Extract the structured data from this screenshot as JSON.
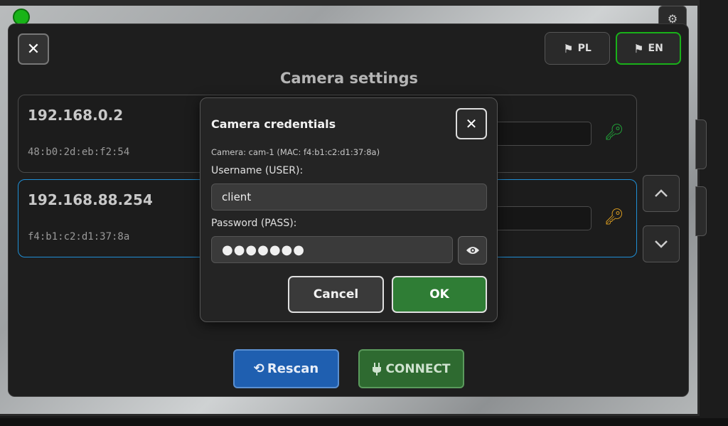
{
  "panel": {
    "title": "Camera settings",
    "close_label": "✕",
    "languages": [
      {
        "code": "PL",
        "flag_glyph": "⚑",
        "active": false
      },
      {
        "code": "EN",
        "flag_glyph": "⚑",
        "active": true
      }
    ]
  },
  "cameras": [
    {
      "ip": "192.168.0.2",
      "mac": "48:b0:2d:eb:f2:54",
      "key_status": "green",
      "selected": false
    },
    {
      "ip": "192.168.88.254",
      "mac": "f4:b1:c2:d1:37:8a",
      "key_status": "gold",
      "selected": true
    }
  ],
  "nav": {
    "up_glyph": "⌃",
    "down_glyph": "⌄"
  },
  "actions": {
    "rescan_icon": "⟲",
    "rescan_label": "Rescan",
    "connect_icon": "⏻",
    "connect_label": "CONNECT"
  },
  "modal": {
    "title": "Camera credentials",
    "close_label": "✕",
    "camera_info": "Camera: cam-1 (MAC: f4:b1:c2:d1:37:8a)",
    "username_label": "Username (USER):",
    "username_value": "client",
    "password_label": "Password (PASS):",
    "password_masked": "●●●●●●●",
    "cancel_label": "Cancel",
    "ok_label": "OK"
  },
  "colors": {
    "accent_green": "#19b119",
    "selected_blue": "#1f8fd6",
    "rescan_blue": "#1f5fb0",
    "connect_green": "#2e6a30",
    "ok_green": "#2f7d35"
  }
}
